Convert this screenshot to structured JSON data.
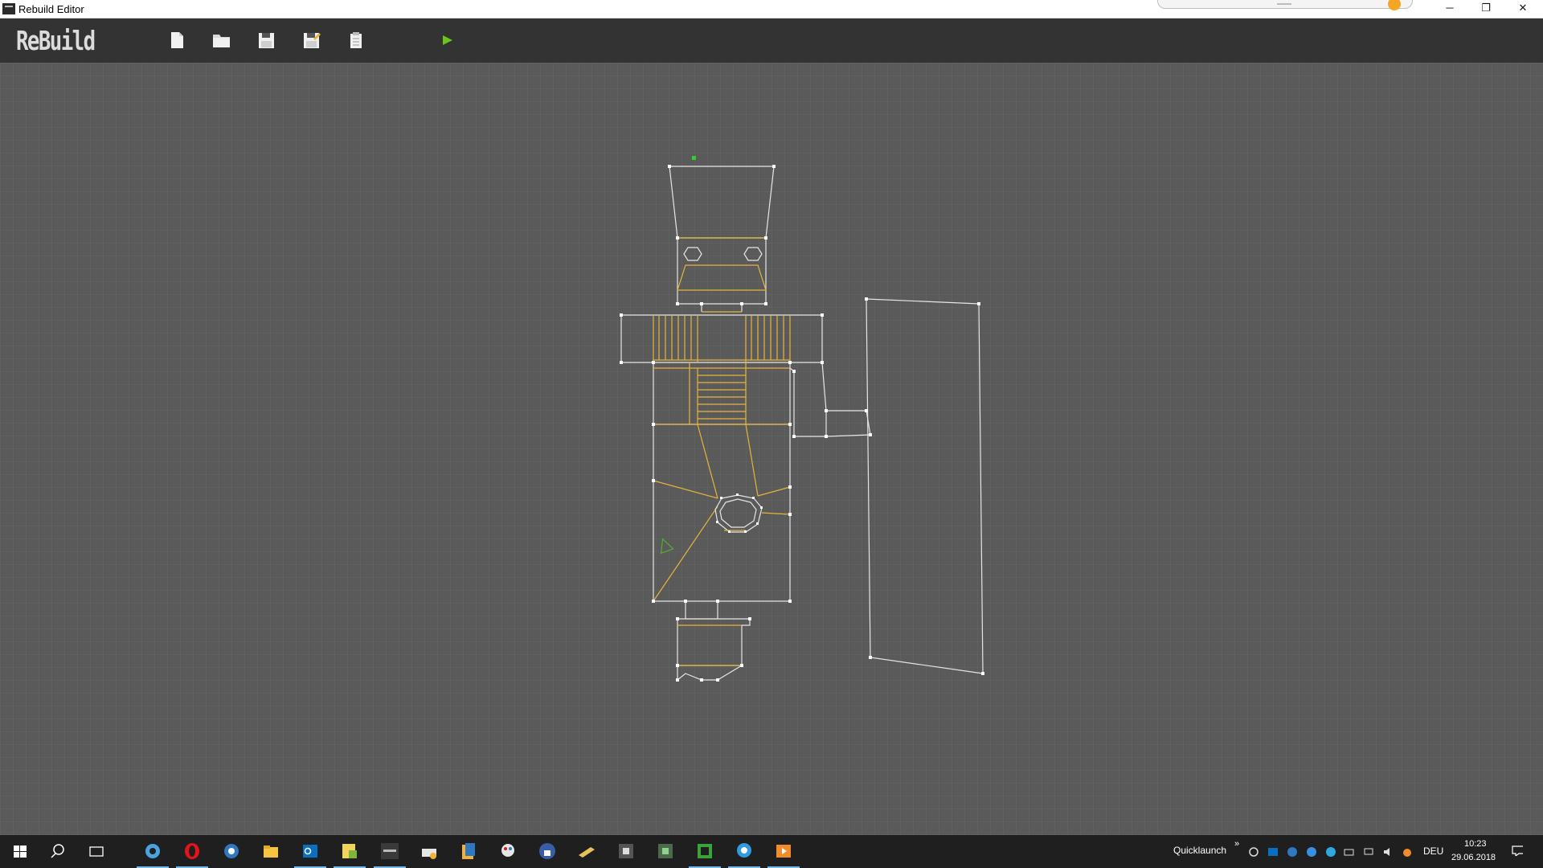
{
  "window": {
    "title": "Rebuild Editor",
    "controls": {
      "minimize": "─",
      "maximize": "❐",
      "close": "✕"
    }
  },
  "toolbar": {
    "logo": "ReBuild",
    "buttons": [
      {
        "name": "new-file-button",
        "icon": "new-file-icon"
      },
      {
        "name": "open-folder-button",
        "icon": "folder-icon"
      },
      {
        "name": "save-button",
        "icon": "floppy-icon"
      },
      {
        "name": "save-as-button",
        "icon": "floppy-edit-icon"
      },
      {
        "name": "clipboard-button",
        "icon": "clipboard-icon"
      },
      {
        "name": "play-button",
        "icon": "play-icon"
      }
    ],
    "accent_play": "#6bc61a"
  },
  "map_editor": {
    "wall_color": "#e6e6e6",
    "sector_color": "#e6b43a",
    "vertex_color": "#ffffff",
    "player_color": "#4fb02a"
  },
  "taskbar": {
    "quicklaunch_label": "Quicklaunch",
    "overflow": "»",
    "language": "DEU",
    "time": "10:23",
    "date": "29.06.2018"
  }
}
